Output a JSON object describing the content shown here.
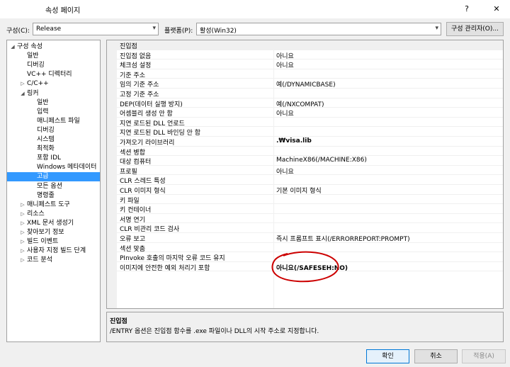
{
  "window": {
    "title": "속성 페이지",
    "help_glyph": "?",
    "close_glyph": "✕"
  },
  "config": {
    "config_label": "구성(C):",
    "config_value": "Release",
    "platform_label": "플랫폼(P):",
    "platform_value": "활성(Win32)",
    "manager_button": "구성 관리자(O)..."
  },
  "tree": {
    "items": [
      {
        "label": "구성 속성",
        "expander": "◢"
      },
      {
        "label": "일반",
        "expander": ""
      },
      {
        "label": "디버깅",
        "expander": ""
      },
      {
        "label": "VC++ 디렉터리",
        "expander": ""
      },
      {
        "label": "C/C++",
        "expander": "▷"
      },
      {
        "label": "링커",
        "expander": "◢"
      },
      {
        "label": "일반",
        "expander": ""
      },
      {
        "label": "입력",
        "expander": ""
      },
      {
        "label": "매니페스트 파일",
        "expander": ""
      },
      {
        "label": "디버깅",
        "expander": ""
      },
      {
        "label": "시스템",
        "expander": ""
      },
      {
        "label": "최적화",
        "expander": ""
      },
      {
        "label": "포함 IDL",
        "expander": ""
      },
      {
        "label": "Windows 메타데이터",
        "expander": ""
      },
      {
        "label": "고급",
        "expander": ""
      },
      {
        "label": "모든 옵션",
        "expander": ""
      },
      {
        "label": "명령줄",
        "expander": ""
      },
      {
        "label": "매니페스트 도구",
        "expander": "▷"
      },
      {
        "label": "리소스",
        "expander": "▷"
      },
      {
        "label": "XML 문서 생성기",
        "expander": "▷"
      },
      {
        "label": "찾아보기 정보",
        "expander": "▷"
      },
      {
        "label": "빌드 이벤트",
        "expander": "▷"
      },
      {
        "label": "사용자 지정 빌드 단계",
        "expander": "▷"
      },
      {
        "label": "코드 분석",
        "expander": "▷"
      }
    ]
  },
  "grid": {
    "header": "진입점",
    "rows": [
      {
        "name": "진입점 없음",
        "value": "아니요"
      },
      {
        "name": "체크섬 설정",
        "value": "아니요"
      },
      {
        "name": "기준 주소",
        "value": ""
      },
      {
        "name": "임의 기준 주소",
        "value": "예(/DYNAMICBASE)"
      },
      {
        "name": "고정 기준 주소",
        "value": ""
      },
      {
        "name": "DEP(데이터 실행 방지)",
        "value": "예(/NXCOMPAT)"
      },
      {
        "name": "어셈블리 생성 안 함",
        "value": "아니요"
      },
      {
        "name": "지연 로드된 DLL 언로드",
        "value": ""
      },
      {
        "name": "지연 로드된 DLL 바인딩 안 함",
        "value": ""
      },
      {
        "name": "가져오기 라이브러리",
        "value": ".₩visa.lib"
      },
      {
        "name": "섹션 병합",
        "value": ""
      },
      {
        "name": "대상 컴퓨터",
        "value": "MachineX86(/MACHINE:X86)"
      },
      {
        "name": "프로필",
        "value": "아니요"
      },
      {
        "name": "CLR 스레드 특성",
        "value": ""
      },
      {
        "name": "CLR 이미지 형식",
        "value": "기본 이미지 형식"
      },
      {
        "name": "키 파일",
        "value": ""
      },
      {
        "name": "키 컨테이너",
        "value": ""
      },
      {
        "name": "서명 연기",
        "value": ""
      },
      {
        "name": "CLR 비관리 코드 검사",
        "value": ""
      },
      {
        "name": "오류 보고",
        "value": "즉시 프롬프트 표시(/ERRORREPORT:PROMPT)"
      },
      {
        "name": "섹션 맞춤",
        "value": ""
      },
      {
        "name": "PInvoke 호출의 마지막 오류 코드 유지",
        "value": ""
      },
      {
        "name": "이미지에 안전한 예외 처리기 포함",
        "value": "아니요(/SAFESEH:NO)"
      }
    ]
  },
  "description": {
    "title": "진입점",
    "text": "/ENTRY 옵션은 진입점 함수를 .exe 파일이나 DLL의 시작 주소로 지정합니다."
  },
  "buttons": {
    "ok": "확인",
    "cancel": "취소",
    "apply": "적용(A)"
  },
  "colors": {
    "selection": "#3399ff",
    "annotation": "#cc0000"
  }
}
